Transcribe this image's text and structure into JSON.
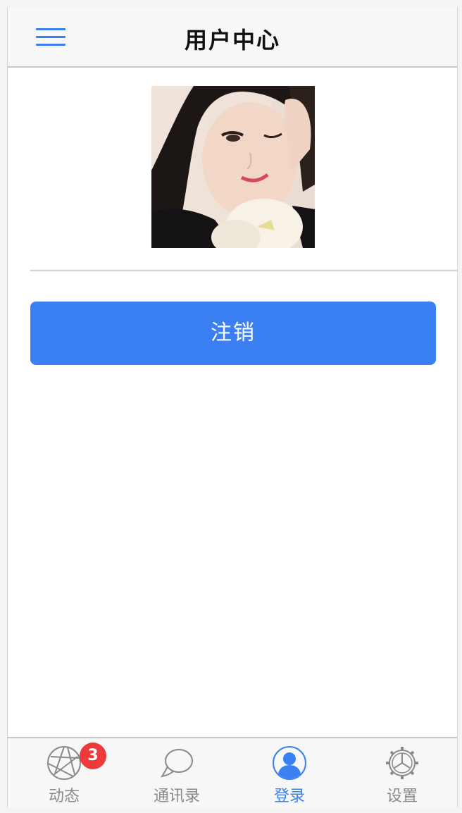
{
  "header": {
    "title": "用户中心",
    "menu_icon": "hamburger-menu-icon"
  },
  "profile": {
    "avatar_alt": "profile-photo"
  },
  "actions": {
    "logout_label": "注销"
  },
  "tabbar": {
    "items": [
      {
        "label": "动态",
        "icon": "aperture-icon",
        "badge": "3",
        "active": false
      },
      {
        "label": "通讯录",
        "icon": "chat-bubble-icon",
        "active": false
      },
      {
        "label": "登录",
        "icon": "user-icon",
        "active": true
      },
      {
        "label": "设置",
        "icon": "gear-icon",
        "active": false
      }
    ]
  },
  "colors": {
    "accent": "#3a80f2",
    "badge": "#ee3a3a",
    "inactive_text": "#8a8a8a"
  }
}
